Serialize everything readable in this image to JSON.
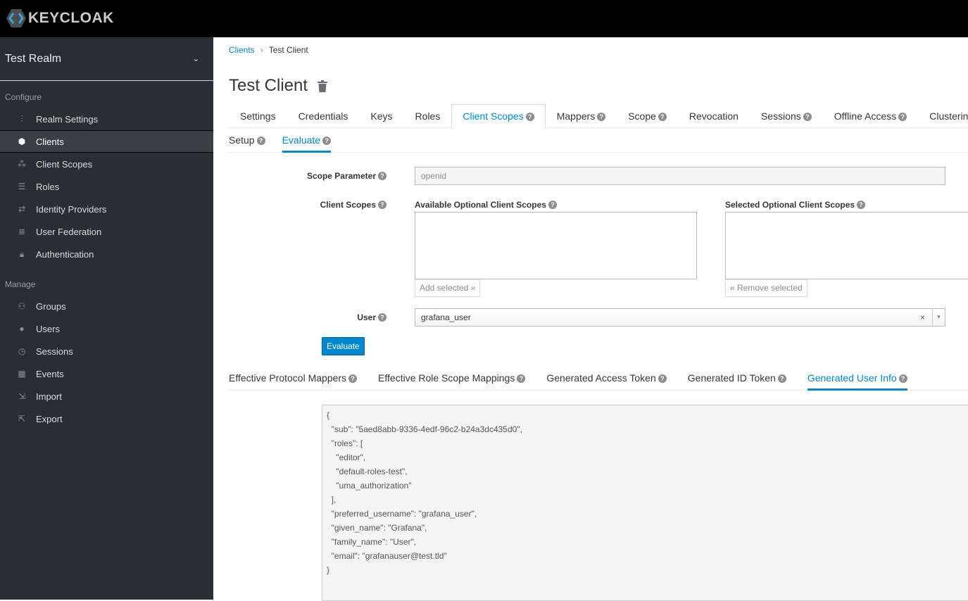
{
  "header": {
    "logo_text": "KEYCLOAK"
  },
  "sidebar": {
    "realm": "Test Realm",
    "configure_label": "Configure",
    "configure_items": [
      {
        "label": "Realm Settings",
        "icon": "sliders-icon"
      },
      {
        "label": "Clients",
        "icon": "cube-icon",
        "active": true
      },
      {
        "label": "Client Scopes",
        "icon": "cubes-icon"
      },
      {
        "label": "Roles",
        "icon": "list-icon"
      },
      {
        "label": "Identity Providers",
        "icon": "exchange-icon"
      },
      {
        "label": "User Federation",
        "icon": "database-icon"
      },
      {
        "label": "Authentication",
        "icon": "lock-icon"
      }
    ],
    "manage_label": "Manage",
    "manage_items": [
      {
        "label": "Groups",
        "icon": "users-icon"
      },
      {
        "label": "Users",
        "icon": "user-icon"
      },
      {
        "label": "Sessions",
        "icon": "clock-icon"
      },
      {
        "label": "Events",
        "icon": "calendar-icon"
      },
      {
        "label": "Import",
        "icon": "import-icon"
      },
      {
        "label": "Export",
        "icon": "export-icon"
      }
    ]
  },
  "breadcrumb": {
    "parent": "Clients",
    "current": "Test Client"
  },
  "page_title": "Test Client",
  "tabs": [
    "Settings",
    "Credentials",
    "Keys",
    "Roles",
    "Client Scopes",
    "Mappers",
    "Scope",
    "Revocation",
    "Sessions",
    "Offline Access",
    "Clustering"
  ],
  "subtabs": [
    "Setup",
    "Evaluate"
  ],
  "form": {
    "scope_param_label": "Scope Parameter",
    "scope_param_value": "openid",
    "client_scopes_label": "Client Scopes",
    "available_label": "Available Optional Client Scopes",
    "selected_label": "Selected Optional Client Scopes",
    "add_selected": "Add selected »",
    "remove_selected": "« Remove selected",
    "user_label": "User",
    "user_value": "grafana_user",
    "evaluate": "Evaluate"
  },
  "result_tabs": [
    "Effective Protocol Mappers",
    "Effective Role Scope Mappings",
    "Generated Access Token",
    "Generated ID Token",
    "Generated User Info"
  ],
  "output_lines": [
    "{",
    "  \"sub\": \"5aed8abb-9336-4edf-96c2-b24a3dc435d0\",",
    "  \"roles\": [",
    "    \"editor\",",
    "    \"default-roles-test\",",
    "    \"uma_authorization\"",
    "  ],",
    "  \"preferred_username\": \"grafana_user\",",
    "  \"given_name\": \"Grafana\",",
    "  \"family_name\": \"User\",",
    "  \"email\": \"grafanauser@test.tld\"",
    "}"
  ]
}
